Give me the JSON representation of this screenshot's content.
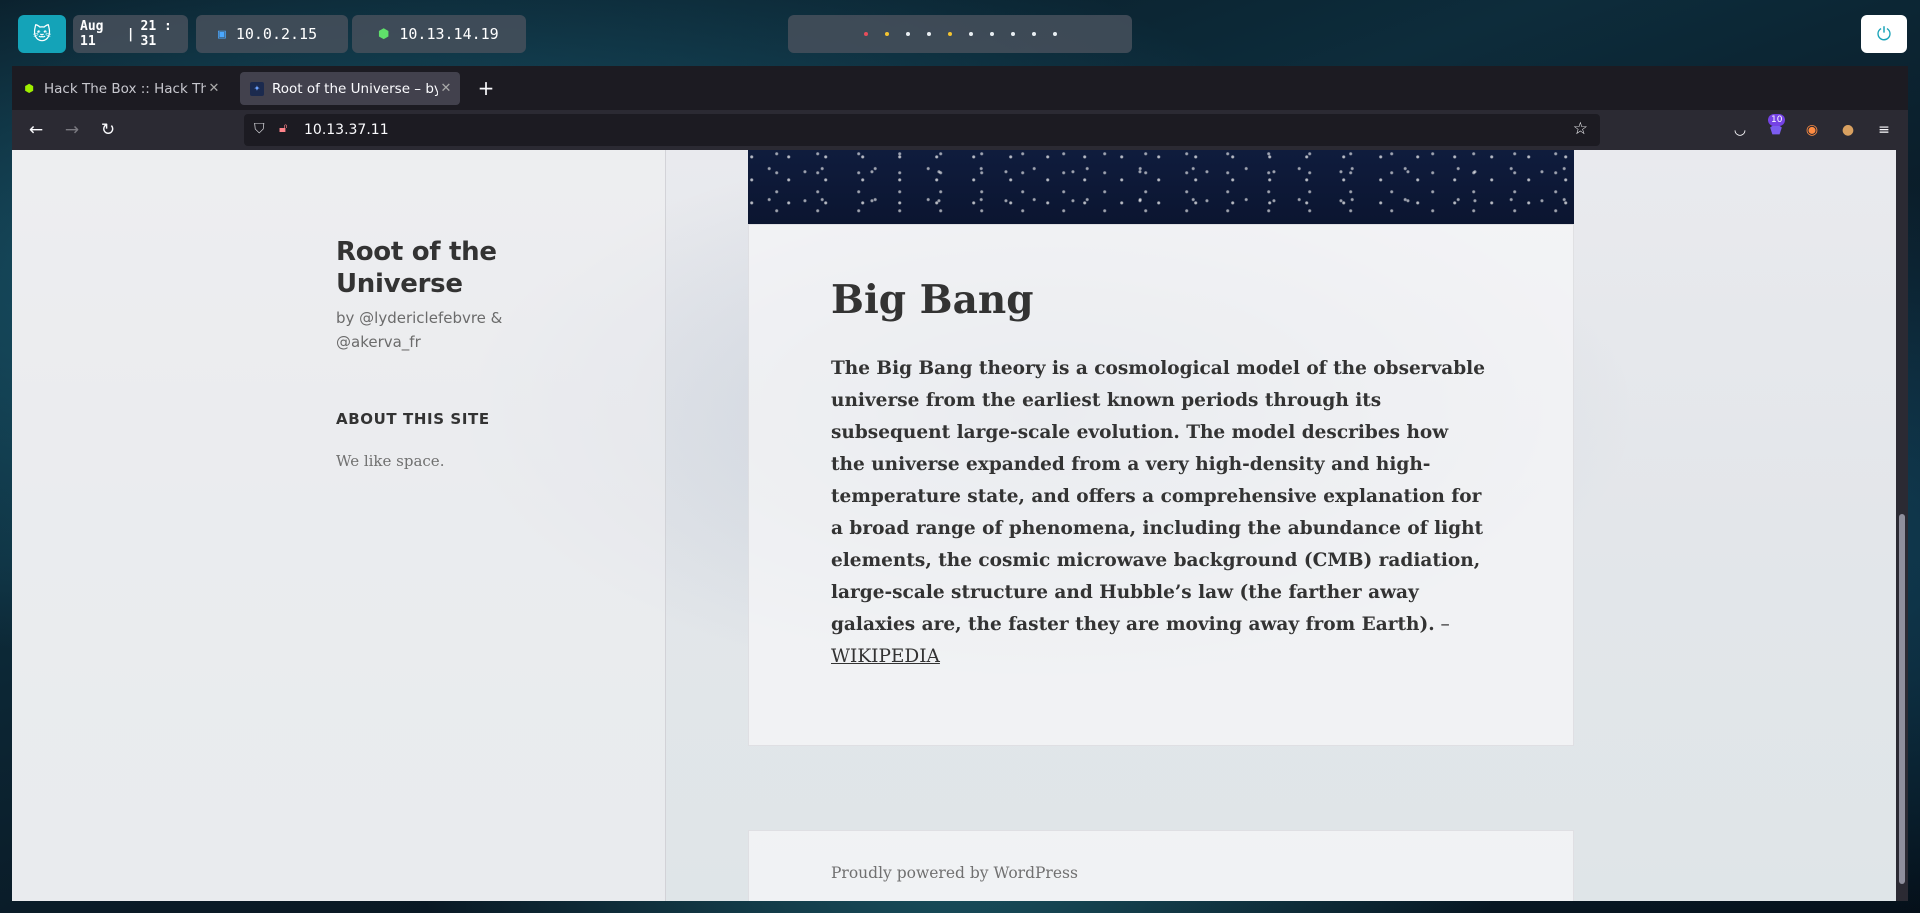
{
  "system_bar": {
    "date": "Aug 11",
    "time": "21 : 31",
    "ip_local": "10.0.2.15",
    "ip_vpn": "10.13.14.19",
    "workspace_dots": [
      "#e84d5b",
      "#f4c430",
      "#e8eef2",
      "#e8eef2",
      "#f4c430",
      "#e8eef2",
      "#e8eef2",
      "#e8eef2",
      "#e8eef2",
      "#e8eef2"
    ]
  },
  "browser": {
    "tabs": [
      {
        "title": "Hack The Box :: Hack The Box",
        "icon": "htb-cube-icon",
        "active": false
      },
      {
        "title": "Root of the Universe – by @lydericlefebvre",
        "icon": "site-favicon",
        "active": true
      }
    ],
    "url": "10.13.37.11",
    "extension_badge": "10"
  },
  "site": {
    "title": "Root of the Universe",
    "description": "by @lydericlefebvre & @akerva_fr",
    "widget_title": "ABOUT THIS SITE",
    "widget_text": "We like space."
  },
  "post": {
    "title": "Big Bang",
    "content": "The Big Bang theory is a cosmological model of the observable universe from the earliest known periods through its subsequent large-scale evolution. The model describes how the universe expanded from a very high-density and high-temperature state, and offers a comprehensive explanation for a broad range of phenomena, including the abundance of light elements, the cosmic microwave background (CMB) radiation, large-scale structure and Hubble’s law (the farther away galaxies are, the faster they are moving away from Earth).",
    "dash": " – ",
    "link_text": "WIKIPEDIA"
  },
  "footer": {
    "text": "Proudly powered by WordPress"
  }
}
